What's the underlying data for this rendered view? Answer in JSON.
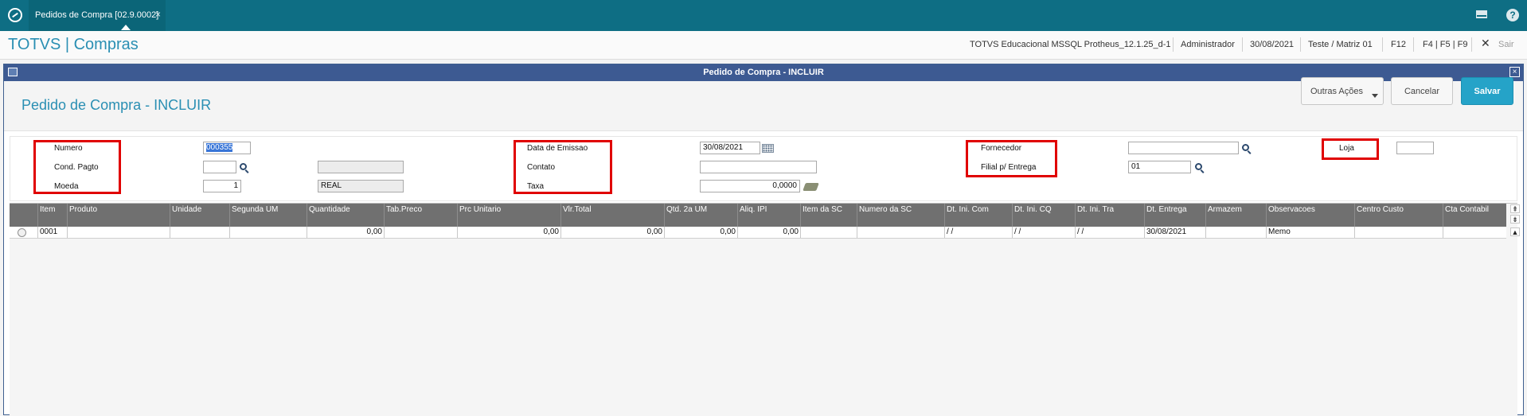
{
  "topbar": {
    "tab_title": "Pedidos de Compra [02.9.0002]",
    "tab_close": "×",
    "help_glyph": "?"
  },
  "appbar": {
    "title": "TOTVS | Compras",
    "environment": "TOTVS Educacional MSSQL Protheus_12.1.25_d-1",
    "user": "Administrador",
    "date": "30/08/2021",
    "company": "Teste / Matriz 01",
    "key_f12": "F12",
    "keys": "F4 | F5 | F9",
    "exit_glyph": "✕",
    "exit_label": "Sair"
  },
  "window": {
    "title": "Pedido de Compra - INCLUIR",
    "close_glyph": "×"
  },
  "form": {
    "title": "Pedido de Compra - INCLUIR",
    "actions": {
      "other": "Outras Ações",
      "cancel": "Cancelar",
      "save": "Salvar"
    },
    "fields": {
      "numero": {
        "label": "Numero",
        "value": "000355"
      },
      "cond_pagto": {
        "label": "Cond. Pagto",
        "value": ""
      },
      "cond_pagto_desc": {
        "value": ""
      },
      "moeda": {
        "label": "Moeda",
        "value": "1"
      },
      "moeda_desc": {
        "value": "REAL"
      },
      "data_emissao": {
        "label": "Data de Emissao",
        "value": "30/08/2021"
      },
      "contato": {
        "label": "Contato",
        "value": ""
      },
      "taxa": {
        "label": "Taxa",
        "value": "0,0000"
      },
      "fornecedor": {
        "label": "Fornecedor",
        "value": ""
      },
      "filial_entrega": {
        "label": "Filial p/ Entrega",
        "value": "01"
      },
      "loja": {
        "label": "Loja",
        "value": ""
      }
    }
  },
  "grid": {
    "columns": [
      "Item",
      "Produto",
      "Unidade",
      "Segunda UM",
      "Quantidade",
      "Tab.Preco",
      "Prc Unitario",
      "Vlr.Total",
      "Qtd. 2a UM",
      "Aliq. IPI",
      "Item da SC",
      "Numero da SC",
      "Dt. Ini. Com",
      "Dt. Ini. CQ",
      "Dt. Ini. Tra",
      "Dt. Entrega",
      "Armazem",
      "Observacoes",
      "Centro Custo",
      "Cta Contabil"
    ],
    "rows": [
      [
        "0001",
        "",
        "",
        "",
        "0,00",
        "",
        "0,00",
        "0,00",
        "0,00",
        "0,00",
        "",
        "",
        " /  /",
        " /  /",
        " /  /",
        "30/08/2021",
        "",
        "Memo",
        "",
        ""
      ]
    ],
    "scroll_glyphs": [
      "⇞",
      "⇟",
      "▲"
    ]
  },
  "colors": {
    "topbar": "#0e6e84",
    "accent": "#2a8fb3",
    "window_title": "#3d5a92",
    "save_button": "#25a3c8",
    "highlight_box": "#e00000"
  }
}
